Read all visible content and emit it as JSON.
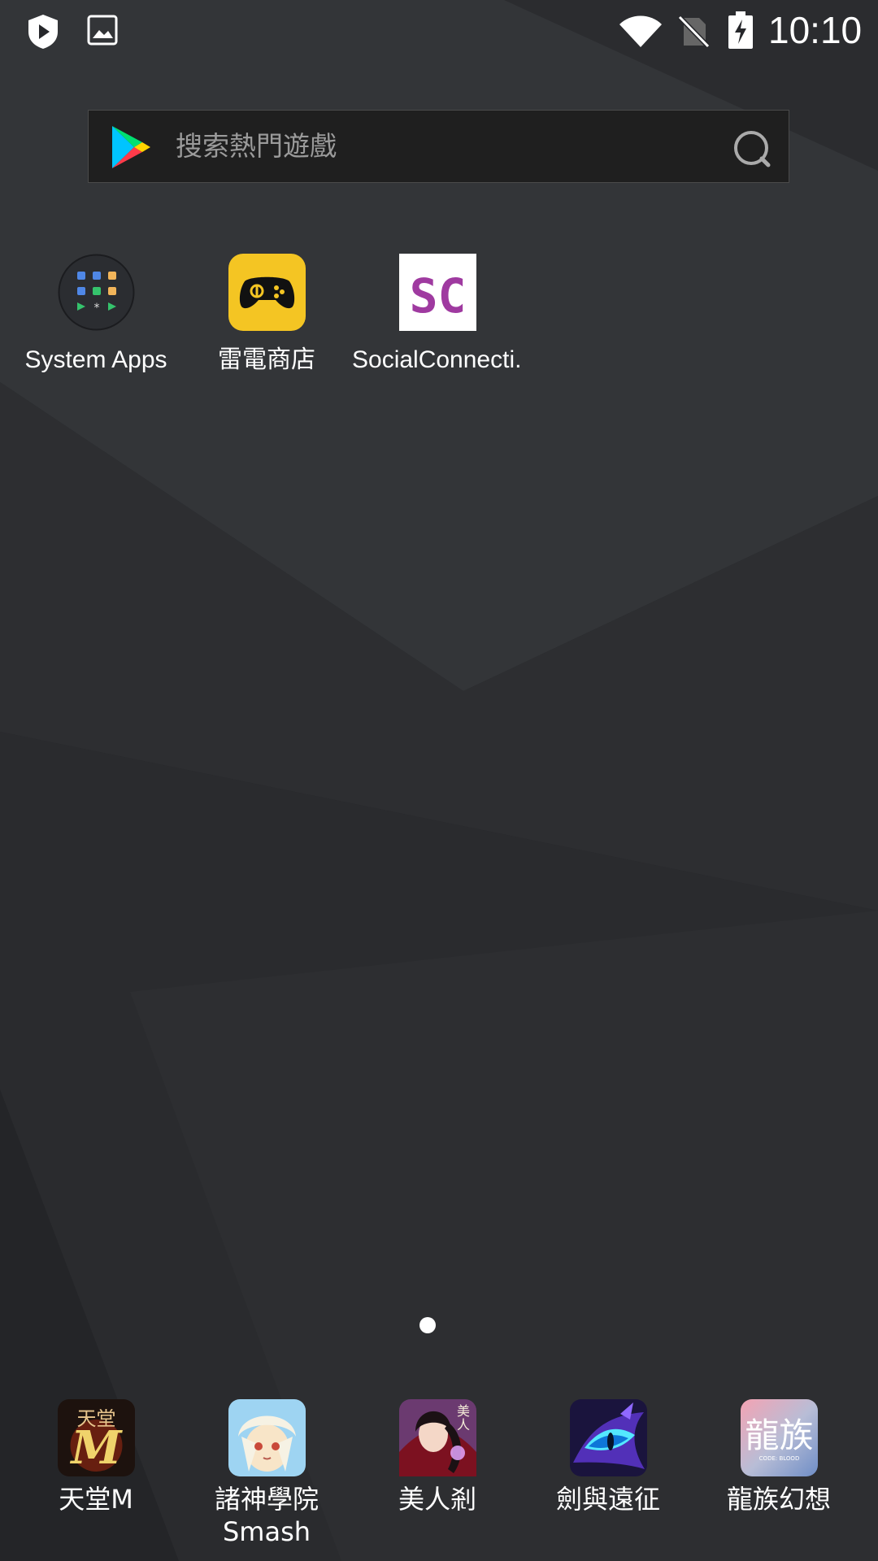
{
  "status_bar": {
    "time": "10:10",
    "left_icons": [
      "shield-play-icon",
      "image-icon"
    ],
    "right_icons": [
      "wifi-icon",
      "no-sim-icon",
      "battery-charging-icon"
    ]
  },
  "search": {
    "placeholder": "搜索熱門遊戲",
    "logo_icon": "google-play-icon",
    "search_icon": "search-icon"
  },
  "home_apps": [
    {
      "label": "System Apps",
      "icon": "folder-icon"
    },
    {
      "label": "雷電商店",
      "icon": "game-controller-icon"
    },
    {
      "label": "SocialConnecti..",
      "icon": "sc-text-icon"
    }
  ],
  "page_indicator": {
    "current": 1,
    "total": 1
  },
  "dock_apps": [
    {
      "label": "天堂M",
      "icon": "lineage-m-icon"
    },
    {
      "label": "諸神學院 Smash",
      "icon": "academy-smash-icon"
    },
    {
      "label": "美人剎",
      "icon": "beauty-icon"
    },
    {
      "label": "劍與遠征",
      "icon": "dragon-eye-icon"
    },
    {
      "label": "龍族幻想",
      "icon": "dragon-clan-icon"
    }
  ],
  "colors": {
    "background": "#26272b",
    "search_bar": "#1f1f1f",
    "search_text": "#9b9b9b",
    "accent_yellow": "#f4c523",
    "accent_purple": "#9f3aa0"
  }
}
